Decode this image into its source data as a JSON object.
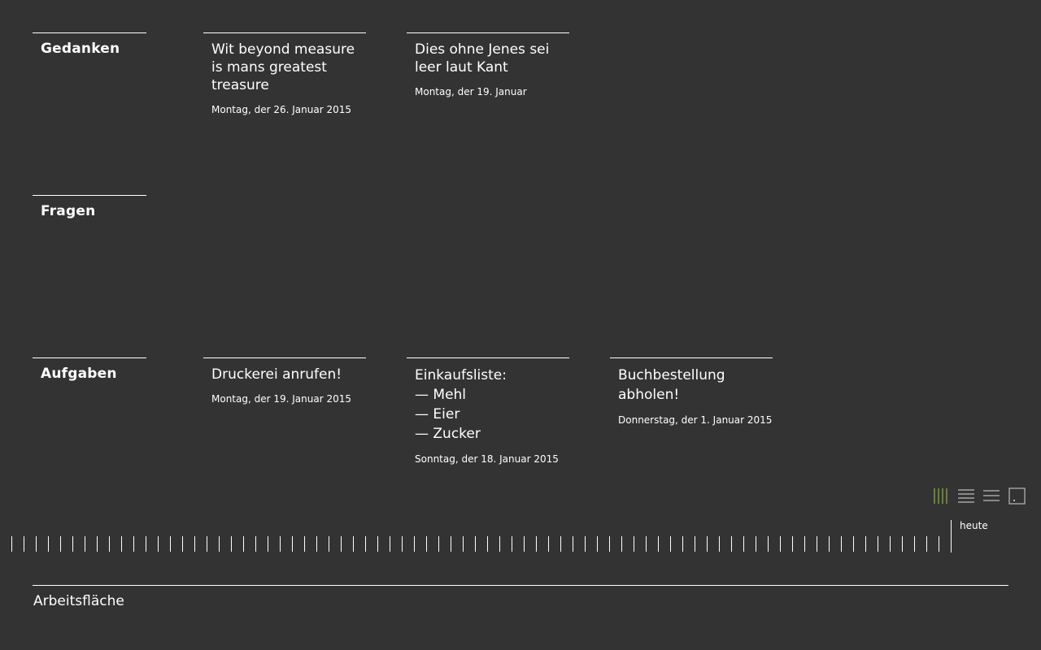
{
  "sections": {
    "gedanken": "Gedanken",
    "fragen": "Fragen",
    "aufgaben": "Aufgaben"
  },
  "notes": [
    {
      "title": "Wit beyond measure\nis mans greatest\ntreasure",
      "date": "Montag, der 26. Januar 2015"
    },
    {
      "title": "Dies ohne Jenes sei\nleer laut Kant",
      "date": "Montag, der 19. Januar"
    }
  ],
  "tasks": [
    {
      "title": "Druckerei anrufen!",
      "date": "Montag, der 19. Januar 2015"
    },
    {
      "title": "Einkaufsliste:\n— Mehl\n— Eier\n— Zucker",
      "date": "Sonntag, der 18. Januar 2015"
    },
    {
      "title": "Buchbestellung\nabholen!",
      "date": "Donnerstag, der 1. Januar 2015"
    }
  ],
  "view_modes": [
    {
      "icon": "columns-icon",
      "active": true
    },
    {
      "icon": "rows-icon",
      "active": false
    },
    {
      "icon": "list-icon",
      "active": false
    },
    {
      "icon": "canvas-icon",
      "active": false
    }
  ],
  "timeline": {
    "today_label": "heute"
  },
  "workspace": {
    "label": "Arbeitsfläche"
  },
  "colors": {
    "background": "#333333",
    "foreground": "#ffffff",
    "accent": "#8cb43c",
    "inactive_icon": "#bbbbbb"
  }
}
